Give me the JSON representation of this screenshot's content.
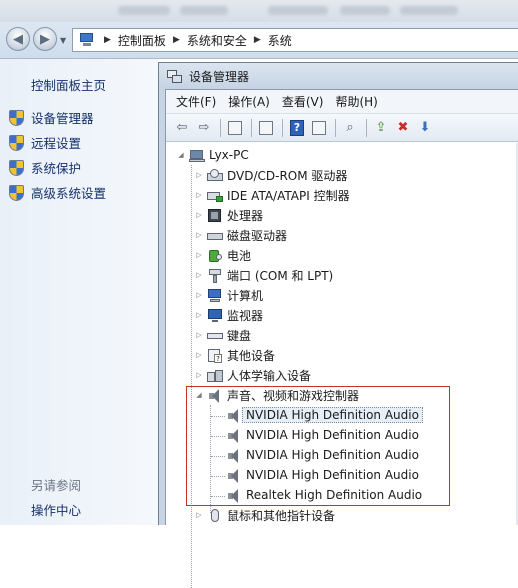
{
  "breadcrumb": {
    "items": [
      "控制面板",
      "系统和安全",
      "系统"
    ]
  },
  "left_panel": {
    "home": "控制面板主页",
    "links": [
      {
        "label": "设备管理器",
        "icon": "shield-icon"
      },
      {
        "label": "远程设置",
        "icon": "shield-icon"
      },
      {
        "label": "系统保护",
        "icon": "shield-icon"
      },
      {
        "label": "高级系统设置",
        "icon": "shield-icon"
      }
    ],
    "see_also": "另请参阅",
    "action_center": "操作中心"
  },
  "device_manager": {
    "title": "设备管理器",
    "menu": [
      "文件(F)",
      "操作(A)",
      "查看(V)",
      "帮助(H)"
    ],
    "toolbar_icons": [
      "back-arrow-icon",
      "forward-arrow-icon",
      "show-hide-console-tree-icon",
      "properties-icon",
      "help-icon",
      "action-pane-icon",
      "scan-hardware-icon",
      "update-driver-icon",
      "uninstall-icon",
      "disable-icon"
    ],
    "tree": {
      "root": "Lyx-PC",
      "categories": [
        {
          "label": "DVD/CD-ROM 驱动器",
          "icon": "disc-drive-icon"
        },
        {
          "label": "IDE ATA/ATAPI 控制器",
          "icon": "ide-controller-icon"
        },
        {
          "label": "处理器",
          "icon": "processor-icon"
        },
        {
          "label": "磁盘驱动器",
          "icon": "disk-drive-icon"
        },
        {
          "label": "电池",
          "icon": "battery-icon"
        },
        {
          "label": "端口 (COM 和 LPT)",
          "icon": "port-icon"
        },
        {
          "label": "计算机",
          "icon": "computer-icon"
        },
        {
          "label": "监视器",
          "icon": "monitor-icon"
        },
        {
          "label": "键盘",
          "icon": "keyboard-icon"
        },
        {
          "label": "其他设备",
          "icon": "unknown-device-icon"
        },
        {
          "label": "人体学输入设备",
          "icon": "hid-icon"
        },
        {
          "label": "声音、视频和游戏控制器",
          "icon": "sound-icon"
        }
      ],
      "sound_children": [
        "NVIDIA High Definition Audio",
        "NVIDIA High Definition Audio",
        "NVIDIA High Definition Audio",
        "NVIDIA High Definition Audio",
        "Realtek High Definition Audio"
      ],
      "last_category": {
        "label": "鼠标和其他指针设备",
        "icon": "mouse-icon"
      }
    }
  },
  "colors": {
    "highlight_box": "#c8322e",
    "link": "#15306b"
  }
}
